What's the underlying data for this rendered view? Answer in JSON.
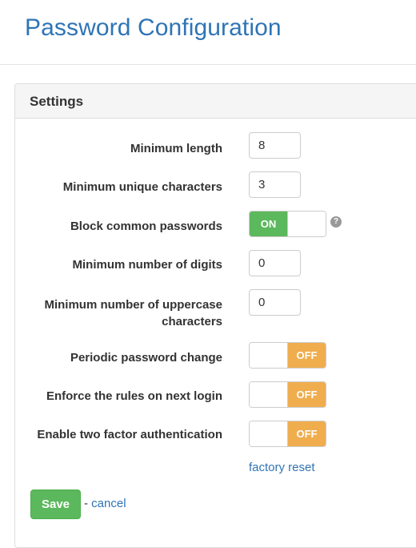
{
  "page": {
    "title": "Password Configuration"
  },
  "panel": {
    "heading": "Settings"
  },
  "fields": {
    "min_length": {
      "label": "Minimum length",
      "value": "8"
    },
    "min_unique": {
      "label": "Minimum unique characters",
      "value": "3"
    },
    "block_common": {
      "label": "Block common passwords",
      "state": "ON",
      "help_glyph": "?"
    },
    "min_digits": {
      "label": "Minimum number of digits",
      "value": "0"
    },
    "min_uppercase": {
      "label_line1": "Minimum number of uppercase",
      "label_line2": "characters",
      "value": "0"
    },
    "periodic_change": {
      "label": "Periodic password change",
      "state": "OFF"
    },
    "enforce_next_login": {
      "label": "Enforce the rules on next login",
      "state": "OFF"
    },
    "two_factor": {
      "label": "Enable two factor authentication",
      "state": "OFF"
    }
  },
  "actions": {
    "factory_reset": "factory reset",
    "save": "Save",
    "separator": "- ",
    "cancel": "cancel"
  },
  "colors": {
    "title": "#2f74b5",
    "toggle_on": "#5cb85c",
    "toggle_off": "#f0ad4e",
    "save_button": "#5cb85c",
    "link": "#2f74b5"
  },
  "icons": {
    "help": "question-circle-icon"
  }
}
